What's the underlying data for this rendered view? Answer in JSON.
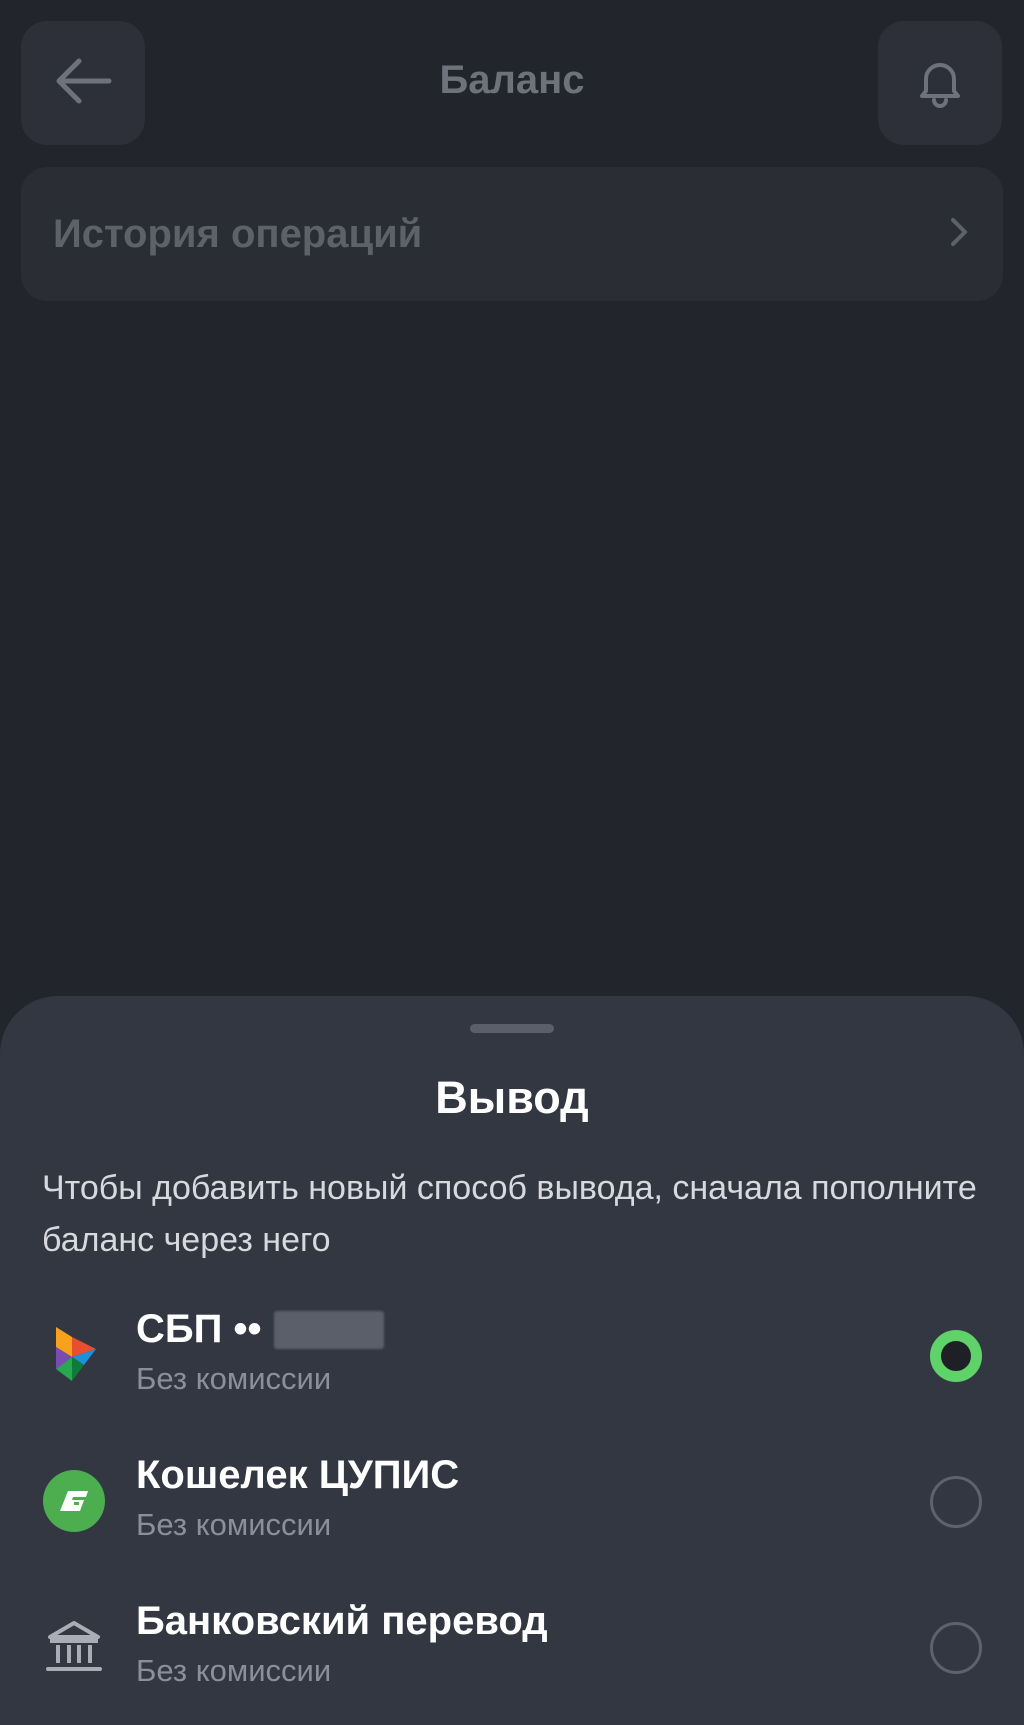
{
  "header": {
    "title": "Баланс",
    "back_icon": "arrow-left-icon",
    "bell_icon": "bell-icon"
  },
  "history": {
    "label": "История операций"
  },
  "sheet": {
    "title": "Вывод",
    "description": "Чтобы добавить новый способ вывода, сначала пополните баланс через него",
    "options": [
      {
        "title": "СБП ••",
        "masked": true,
        "subtitle": "Без комиссии",
        "icon": "sbp-logo-icon",
        "selected": true
      },
      {
        "title": "Кошелек ЦУПИС",
        "subtitle": "Без комиссии",
        "icon": "cupis-wallet-icon",
        "selected": false
      },
      {
        "title": "Банковский перевод",
        "subtitle": "Без комиссии",
        "icon": "bank-icon",
        "selected": false
      }
    ]
  },
  "colors": {
    "background": "#22252c",
    "sheet": "#333742",
    "accent_green": "#5fd36a"
  }
}
